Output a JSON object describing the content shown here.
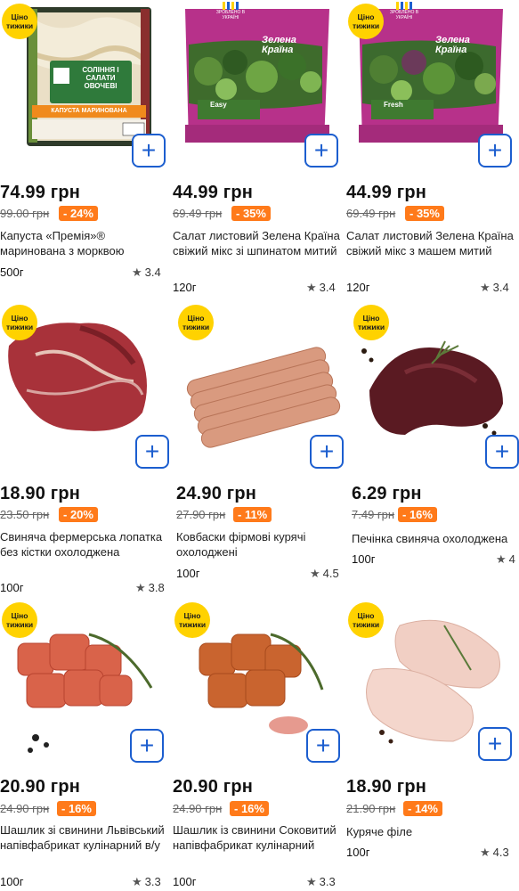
{
  "badge": {
    "line1": "Ціно",
    "line2": "тижики"
  },
  "made_in": "ЗРОБЛЕНО В УКРАЇНІ",
  "add_symbol": "+",
  "products": [
    {
      "price": "74.99 грн",
      "old": "99.00 грн",
      "disc": "- 24%",
      "name": "Капуста «Премія»® маринована з морквою",
      "weight": "500г",
      "rating": "3.4",
      "label_top": "СОЛІННЯ І САЛАТИ ОВОЧЕВІ",
      "label_bottom": "КАПУСТА МАРИНОВАНА"
    },
    {
      "price": "44.99 грн",
      "old": "69.49 грн",
      "disc": "- 35%",
      "name": "Салат листовий Зелена Країна свіжий мікс зі шпинатом митий",
      "weight": "120г",
      "rating": "3.4",
      "brand": "Зелена Країна",
      "variant": "Easy"
    },
    {
      "price": "44.99 грн",
      "old": "69.49 грн",
      "disc": "- 35%",
      "name": "Салат листовий Зелена Країна свіжий мікс з машем митий",
      "weight": "120г",
      "rating": "3.4",
      "brand": "Зелена Країна",
      "variant": "Fresh"
    },
    {
      "price": "18.90 грн",
      "old": "23.50 грн",
      "disc": "- 20%",
      "name": "Свиняча фермерська лопатка без кістки охолоджена",
      "weight": "100г",
      "rating": "3.8"
    },
    {
      "price": "24.90 грн",
      "old": "27.90 грн",
      "disc": "- 11%",
      "name": "Ковбаски фірмові курячі охолоджені",
      "weight": "100г",
      "rating": "4.5"
    },
    {
      "price": "6.29 грн",
      "old": "7.49 грн",
      "disc": "- 16%",
      "name": "Печінка свиняча охолоджена",
      "weight": "100г",
      "rating": "4"
    },
    {
      "price": "20.90 грн",
      "old": "24.90 грн",
      "disc": "- 16%",
      "name": "Шашлик зі свинини Львівський напівфабрикат кулінарний в/у",
      "weight": "100г",
      "rating": "3.3"
    },
    {
      "price": "20.90 грн",
      "old": "24.90 грн",
      "disc": "- 16%",
      "name": "Шашлик із свинини Соковитий напівфабрикат кулінарний",
      "weight": "100г",
      "rating": "3.3"
    },
    {
      "price": "18.90 грн",
      "old": "21.90 грн",
      "disc": "- 14%",
      "name": "Куряче філе",
      "weight": "100г",
      "rating": "4.3"
    }
  ]
}
